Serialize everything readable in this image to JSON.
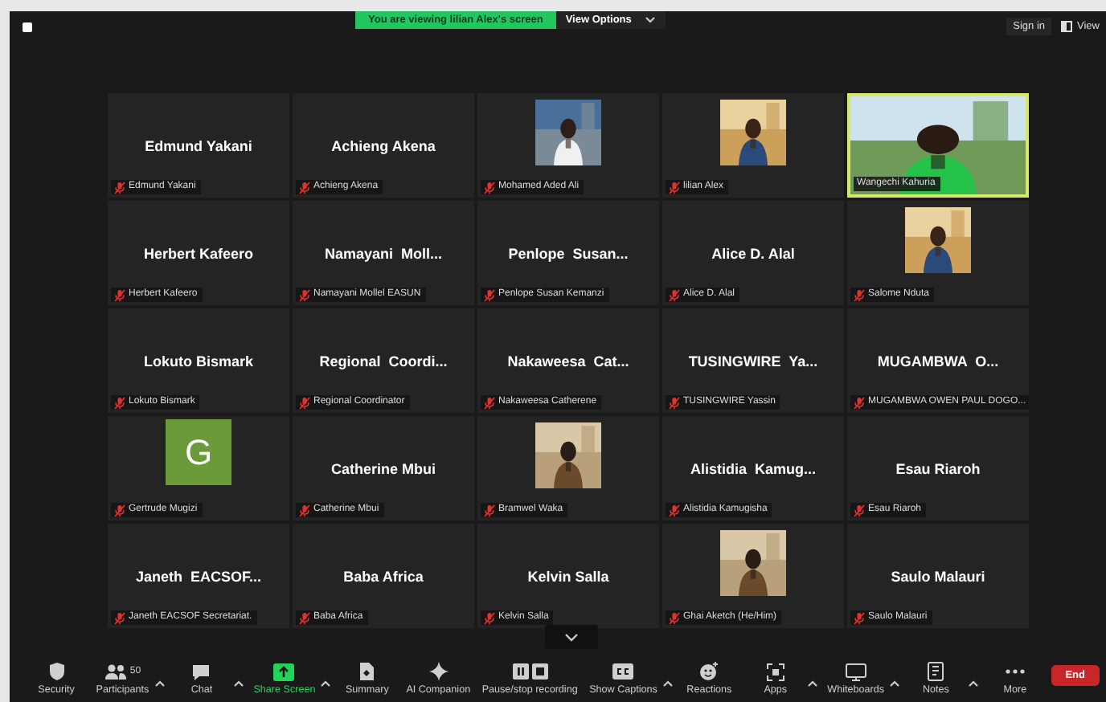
{
  "banner": {
    "text": "You are viewing lilian Alex's screen",
    "view_options": "View Options"
  },
  "top_right": {
    "sign_in": "Sign in",
    "view": "View"
  },
  "tiles": [
    {
      "kind": "name",
      "display_name": "Edmund Yakani",
      "label": "Edmund Yakani",
      "muted": true,
      "active": false
    },
    {
      "kind": "name",
      "display_name": "Achieng Akena",
      "label": "Achieng Akena",
      "muted": true,
      "active": false
    },
    {
      "label": "Mohamed Aded Ali",
      "muted": true,
      "active": false
    },
    {
      "label": "lilian Alex",
      "muted": true,
      "active": false
    },
    {
      "kind": "video",
      "label": "Wangechi Kahuria",
      "muted": false,
      "active": true
    },
    {
      "kind": "name",
      "display_name": "Herbert Kafeero",
      "label": "Herbert Kafeero",
      "muted": true,
      "active": false
    },
    {
      "kind": "name",
      "display_name": "Namayani  Moll...",
      "label": "Namayani Mollel EASUN",
      "muted": true,
      "active": false
    },
    {
      "kind": "name",
      "display_name": "Penlope  Susan...",
      "label": "Penlope Susan Kemanzi",
      "muted": true,
      "active": false
    },
    {
      "kind": "name",
      "display_name": "Alice D. Alal",
      "label": "Alice D. Alal",
      "muted": true,
      "active": false
    },
    {
      "label": "Salome Nduta",
      "muted": true,
      "active": false
    },
    {
      "kind": "name",
      "display_name": "Lokuto Bismark",
      "label": "Lokuto Bismark",
      "muted": true,
      "active": false
    },
    {
      "kind": "name",
      "display_name": "Regional  Coordi...",
      "label": "Regional Coordinator",
      "muted": true,
      "active": false
    },
    {
      "kind": "name",
      "display_name": "Nakaweesa  Cat...",
      "label": "Nakaweesa Catherene",
      "muted": true,
      "active": false
    },
    {
      "kind": "name",
      "display_name": "TUSINGWIRE  Ya...",
      "label": "TUSINGWIRE Yassin",
      "muted": true,
      "active": false
    },
    {
      "kind": "name",
      "display_name": "MUGAMBWA  O...",
      "label": "MUGAMBWA OWEN PAUL DOGO...",
      "muted": true,
      "active": false
    },
    {
      "kind": "avatar",
      "initial": "G",
      "color": "#6a9a3a",
      "label": "Gertrude Mugizi",
      "muted": true,
      "active": false
    },
    {
      "kind": "name",
      "display_name": "Catherine Mbui",
      "label": "Catherine Mbui",
      "muted": true,
      "active": false
    },
    {
      "label": "Bramwel Waka",
      "muted": true,
      "active": false
    },
    {
      "kind": "name",
      "display_name": "Alistidia  Kamug...",
      "label": "Alistidia Kamugisha",
      "muted": true,
      "active": false
    },
    {
      "kind": "name",
      "display_name": "Esau Riaroh",
      "label": "Esau Riaroh",
      "muted": true,
      "active": false
    },
    {
      "kind": "name",
      "display_name": "Janeth  EACSOF...",
      "label": "Janeth EACSOF Secretariat.",
      "muted": true,
      "active": false
    },
    {
      "kind": "name",
      "display_name": "Baba Africa",
      "label": "Baba Africa",
      "muted": true,
      "active": false
    },
    {
      "kind": "name",
      "display_name": "Kelvin Salla",
      "label": "Kelvin Salla",
      "muted": true,
      "active": false
    },
    {
      "label": "Ghai Aketch (He/Him)",
      "muted": true,
      "active": false
    },
    {
      "kind": "name",
      "display_name": "Saulo Malauri",
      "label": "Saulo Malauri",
      "muted": true,
      "active": false
    }
  ],
  "toolbar": [
    {
      "label": "Security",
      "caret": false,
      "active": false
    },
    {
      "label": "Participants",
      "count": "50",
      "caret": true,
      "active": false
    },
    {
      "label": "Chat",
      "caret": true,
      "active": false
    },
    {
      "label": "Share Screen",
      "caret": true,
      "active": true
    },
    {
      "label": "Summary",
      "caret": false,
      "active": false
    },
    {
      "label": "AI Companion",
      "caret": false,
      "active": false
    },
    {
      "label": "Pause/stop recording",
      "caret": false,
      "active": false
    },
    {
      "label": "Show Captions",
      "caret": true,
      "active": false
    },
    {
      "label": "Reactions",
      "caret": false,
      "active": false
    },
    {
      "label": "Apps",
      "caret": true,
      "active": false
    },
    {
      "label": "Whiteboards",
      "caret": true,
      "active": false
    },
    {
      "label": "Notes",
      "caret": true,
      "active": false
    },
    {
      "label": "More",
      "caret": false,
      "active": false
    }
  ],
  "end_button": "End"
}
